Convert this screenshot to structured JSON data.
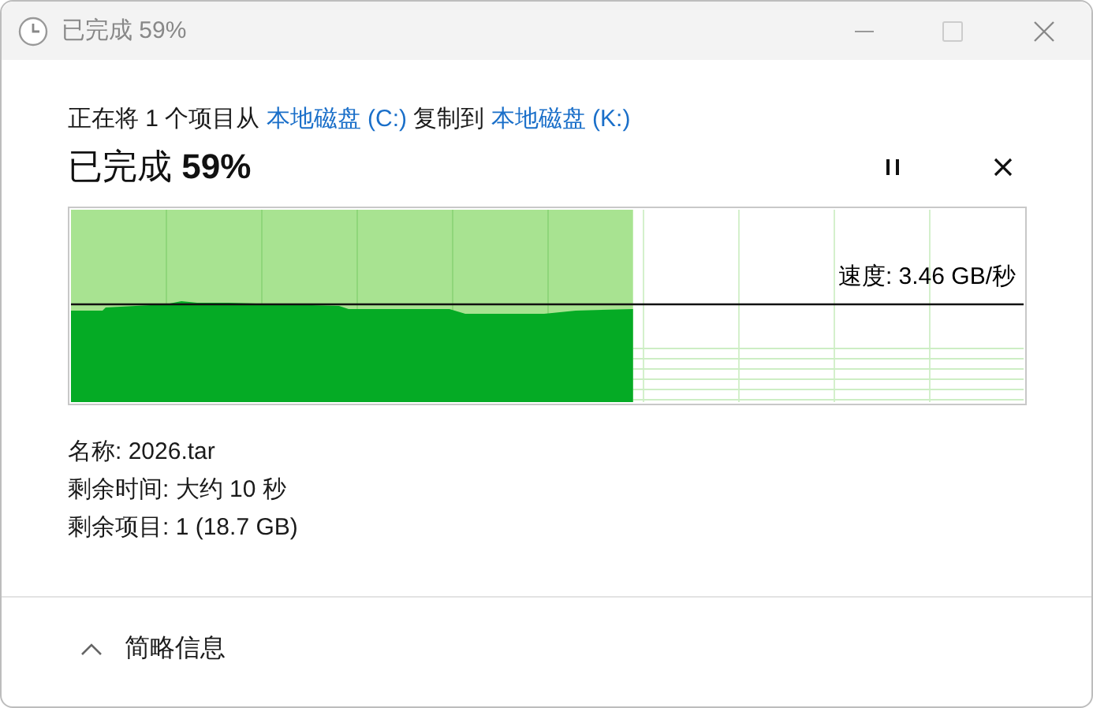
{
  "window": {
    "title": "已完成 59%"
  },
  "description": [
    {
      "kind": "text",
      "text": "正在将 1 个项目从"
    },
    {
      "kind": "link",
      "text": "本地磁盘 (C:)"
    },
    {
      "kind": "text",
      "text": "复制到"
    },
    {
      "kind": "link",
      "text": "本地磁盘 (K:)"
    }
  ],
  "heading": "已完成 **59%**",
  "progress": {
    "level": 0.59,
    "speed": "速度: 3.46 GB/秒"
  },
  "details": [
    "名称: 2026.tar",
    "剩余时间: 大约 10 秒",
    "剩余项目: 1 (18.7 GB)"
  ],
  "footer": {
    "toggle": "简略信息",
    "expanded": true
  }
}
